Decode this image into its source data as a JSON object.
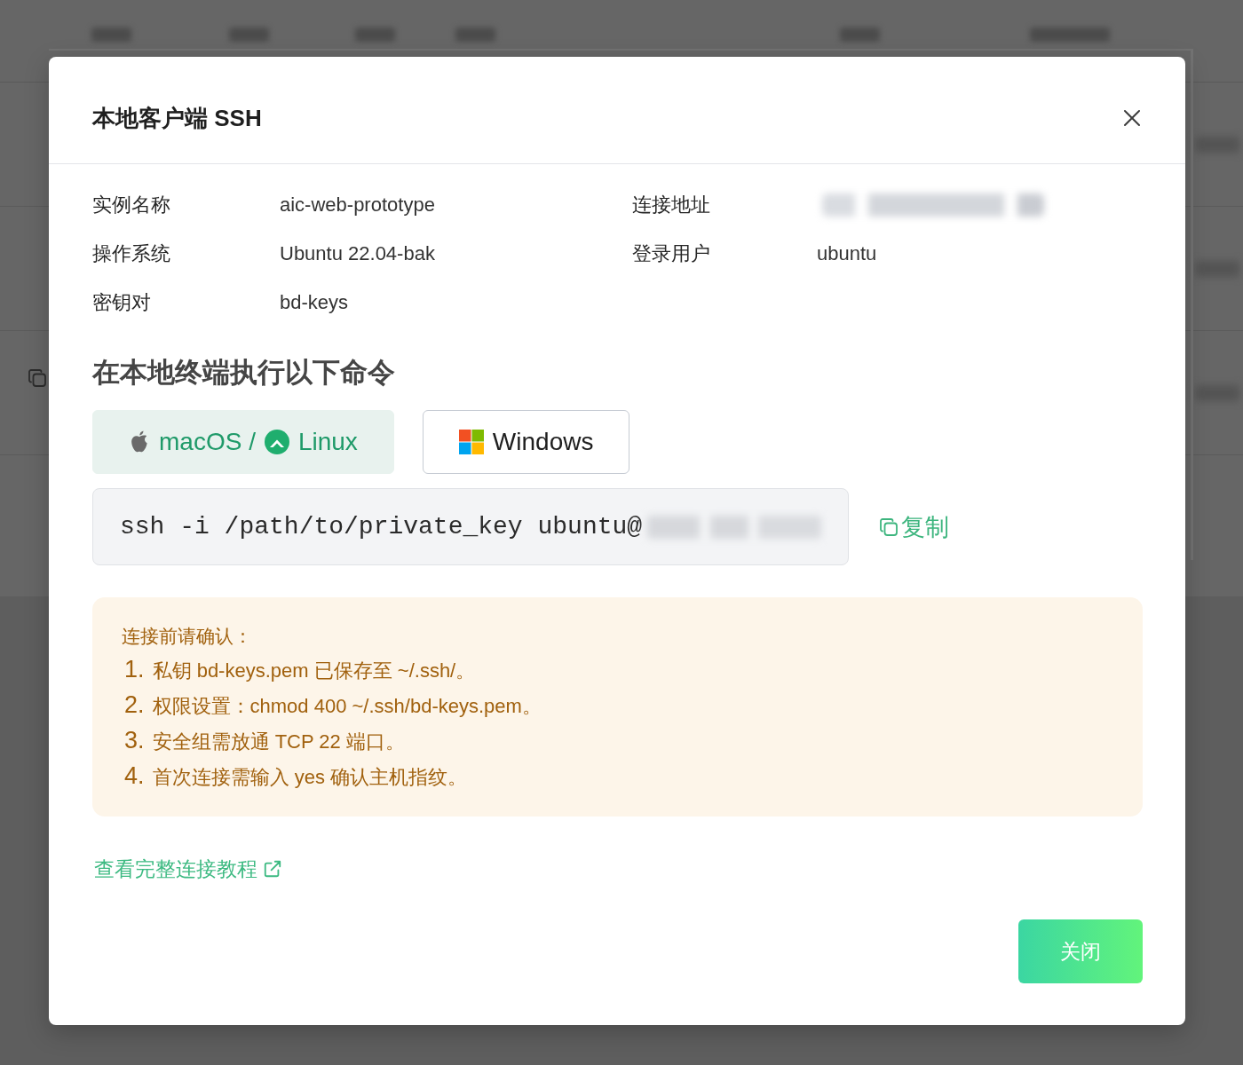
{
  "dialog": {
    "title": "本地客户端 SSH"
  },
  "info": [
    {
      "label": "实例名称",
      "kind": "text",
      "value": "aic-web-prototype"
    },
    {
      "label": "连接地址",
      "kind": "redacted"
    },
    {
      "label": "操作系统",
      "kind": "text",
      "value": "Ubuntu 22.04-bak"
    },
    {
      "label": "登录用户",
      "kind": "text",
      "value": "ubuntu"
    },
    {
      "label": "密钥对",
      "kind": "text",
      "value": "bd-keys"
    }
  ],
  "command_section": {
    "heading": "在本地终端执行以下命令",
    "tabs": [
      {
        "labels": [
          "macOS /",
          "Linux"
        ],
        "selected": true
      },
      {
        "labels": [
          "Windows"
        ],
        "selected": false
      }
    ],
    "command": {
      "text": "ssh -i /path/to/private_key ubuntu@",
      "host_redacted": true
    },
    "copy_button": "复制"
  },
  "notice": {
    "title": "连接前请确认：",
    "items": [
      {
        "number": "1.",
        "text": "私钥 bd-keys.pem 已保存至 ~/.ssh/。"
      },
      {
        "number": "2.",
        "text": "权限设置：chmod 400 ~/.ssh/bd-keys.pem。"
      },
      {
        "number": "3.",
        "text": "安全组需放通 TCP 22 端口。"
      },
      {
        "number": "4.",
        "text": "首次连接需输入 yes 确认主机指纹。"
      }
    ]
  },
  "tutorial_link": "查看完整连接教程",
  "buttons": [
    "关闭"
  ]
}
